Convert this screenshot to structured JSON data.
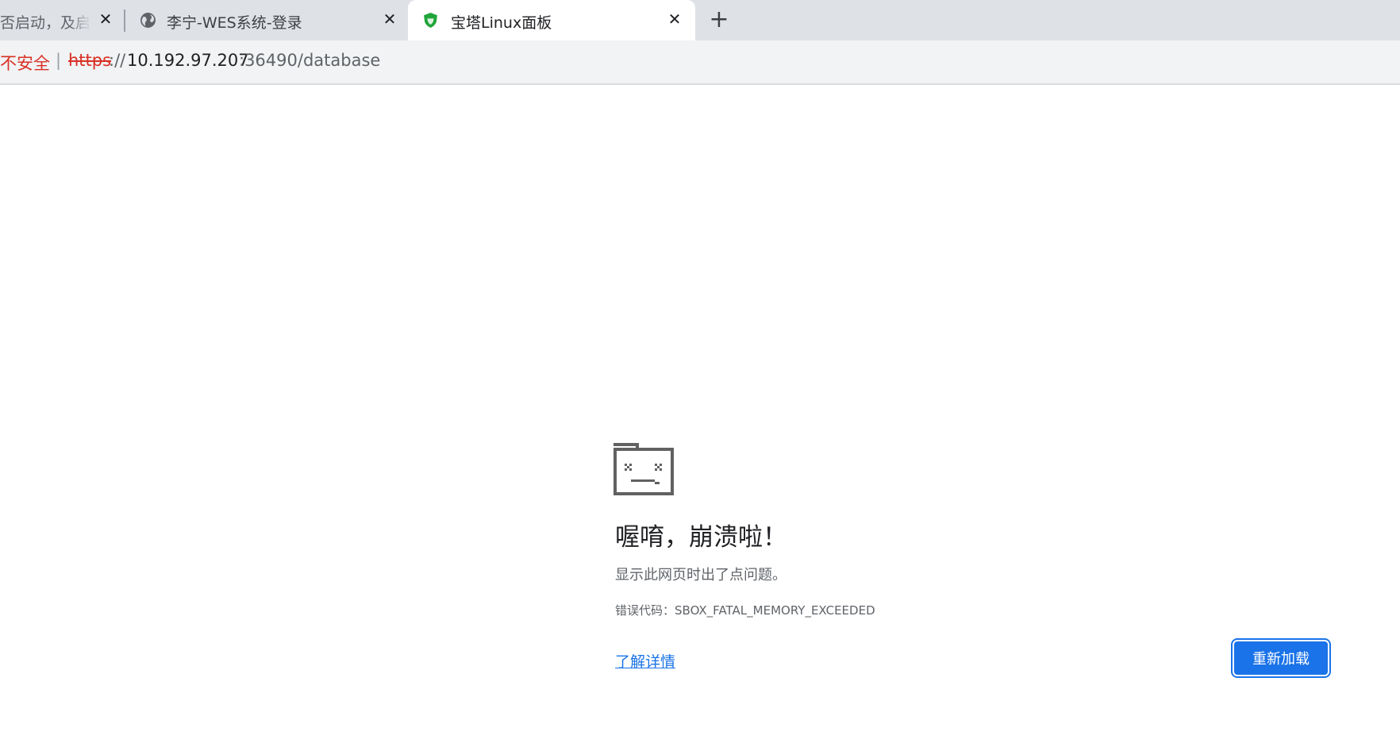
{
  "tabs": [
    {
      "title": "否启动，及启动",
      "icon": "none",
      "close": "✕"
    },
    {
      "title": "李宁-WES系统-登录",
      "icon": "globe-icon",
      "close": "✕"
    },
    {
      "title": "宝塔Linux面板",
      "icon": "bt-shield-icon",
      "close": "✕",
      "active": true
    }
  ],
  "new_tab_label": "+",
  "omnibox": {
    "security_text": "不安全",
    "separator": "|",
    "scheme": "https",
    "scheme_sep": "://",
    "host": "10.192.97.207",
    "path": ":36490/database"
  },
  "error_page": {
    "icon": "sad-folder-icon",
    "heading": "喔唷，崩溃啦！",
    "message": "显示此网页时出了点问题。",
    "error_code_label": "错误代码：",
    "error_code": "SBOX_FATAL_MEMORY_EXCEEDED",
    "learn_more": "了解详情",
    "reload": "重新加载"
  },
  "colors": {
    "accent": "#1a73e8",
    "danger": "#d93025",
    "tabstrip": "#dee1e6",
    "toolbar": "#f1f3f4",
    "bt_green": "#20a53a"
  }
}
